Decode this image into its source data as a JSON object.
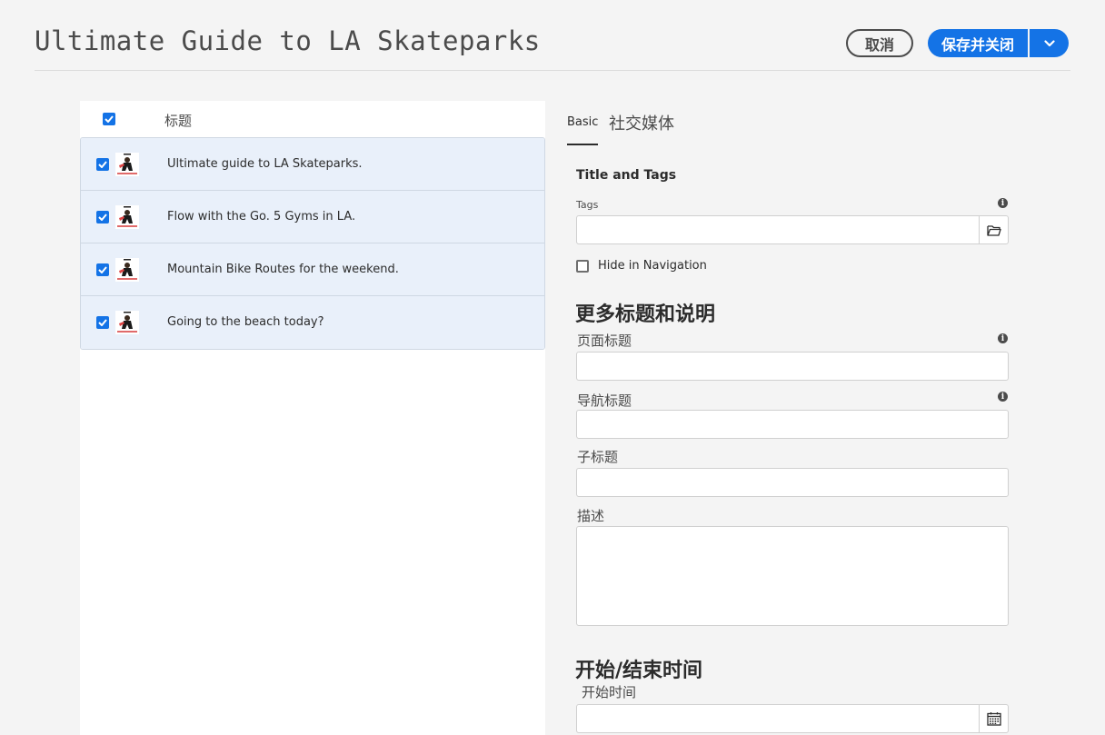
{
  "header": {
    "title": "Ultimate Guide to LA Skateparks",
    "cancel_label": "取消",
    "save_label": "保存并关闭"
  },
  "list": {
    "column_header": "标题",
    "rows": [
      {
        "label": "Ultimate guide to LA Skateparks.",
        "checked": true
      },
      {
        "label": "Flow with the Go. 5 Gyms in LA.",
        "checked": true
      },
      {
        "label": "Mountain Bike Routes for the weekend.",
        "checked": true
      },
      {
        "label": "Going to the beach today?",
        "checked": true
      }
    ]
  },
  "tabs": [
    {
      "label": "Basic",
      "active": true
    },
    {
      "label": "社交媒体",
      "active": false
    }
  ],
  "form": {
    "title_and_tags": "Title and Tags",
    "tags_label": "Tags",
    "tags_value": "",
    "hide_in_nav_label": "Hide in Navigation",
    "hide_in_nav_checked": false,
    "more_titles_heading": "更多标题和说明",
    "page_title_label": "页面标题",
    "nav_title_label": "导航标题",
    "subtitle_label": "子标题",
    "description_label": "描述",
    "on_off_time_heading": "开始/结束时间",
    "on_time_label": "开始时间"
  },
  "colors": {
    "accent": "#1473e6",
    "row_selected": "#e9f0fa"
  },
  "icons": {
    "folder": "folder-icon",
    "calendar": "calendar-icon",
    "info": "info-icon",
    "chevron": "chevron-down-icon",
    "check": "checkmark-icon"
  }
}
